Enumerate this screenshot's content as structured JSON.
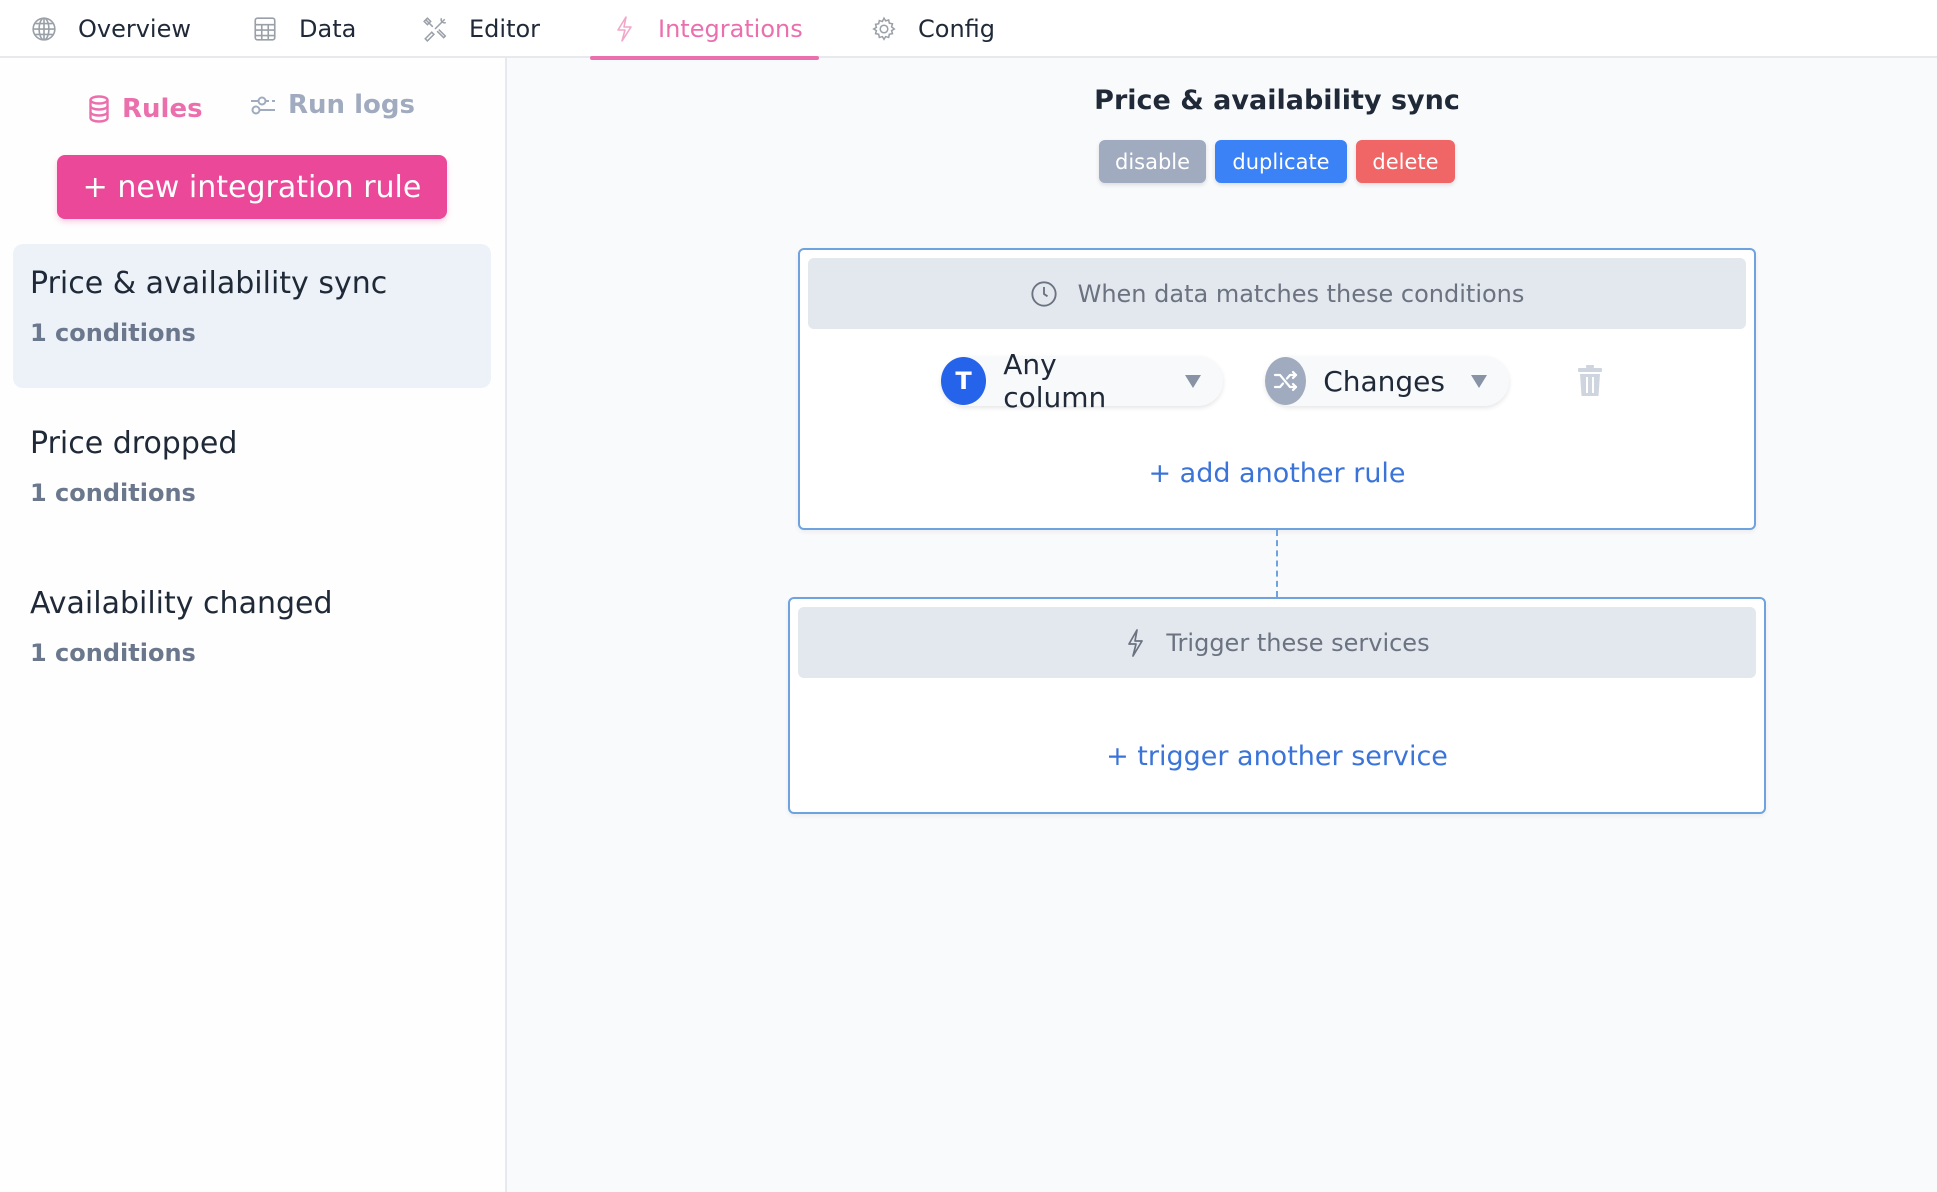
{
  "nav": {
    "items": [
      {
        "label": "Overview",
        "icon": "globe-icon"
      },
      {
        "label": "Data",
        "icon": "table-icon"
      },
      {
        "label": "Editor",
        "icon": "tools-icon"
      },
      {
        "label": "Integrations",
        "icon": "lightning-icon",
        "active": true
      },
      {
        "label": "Config",
        "icon": "gear-icon"
      }
    ]
  },
  "sidebar": {
    "tabs": [
      {
        "label": "Rules",
        "icon": "database-icon",
        "active": true
      },
      {
        "label": "Run logs",
        "icon": "sliders-icon"
      }
    ],
    "new_rule_label": "+ new integration rule",
    "rules": [
      {
        "name": "Price & availability sync",
        "conditions": "1 conditions",
        "selected": true
      },
      {
        "name": "Price dropped",
        "conditions": "1 conditions"
      },
      {
        "name": "Availability changed",
        "conditions": "1 conditions"
      }
    ]
  },
  "main": {
    "title": "Price & availability sync",
    "actions": {
      "disable": "disable",
      "duplicate": "duplicate",
      "delete": "delete"
    },
    "conditions_card": {
      "header": "When data matches these conditions",
      "header_icon": "clock-icon",
      "rule": {
        "column_badge": "T",
        "column": "Any column",
        "operator_icon": "shuffle-icon",
        "operator": "Changes"
      },
      "add_label": "+ add another rule"
    },
    "trigger_card": {
      "header": "Trigger these services",
      "header_icon": "lightning-icon",
      "add_label": "+ trigger another service"
    }
  },
  "colors": {
    "accent": "#ec4899",
    "active_tab": "#ec6fad",
    "primary": "#3b82f6",
    "danger": "#f06565",
    "muted": "#a0abc0",
    "link": "#3b74d8",
    "card_border": "#6fa3e0"
  }
}
